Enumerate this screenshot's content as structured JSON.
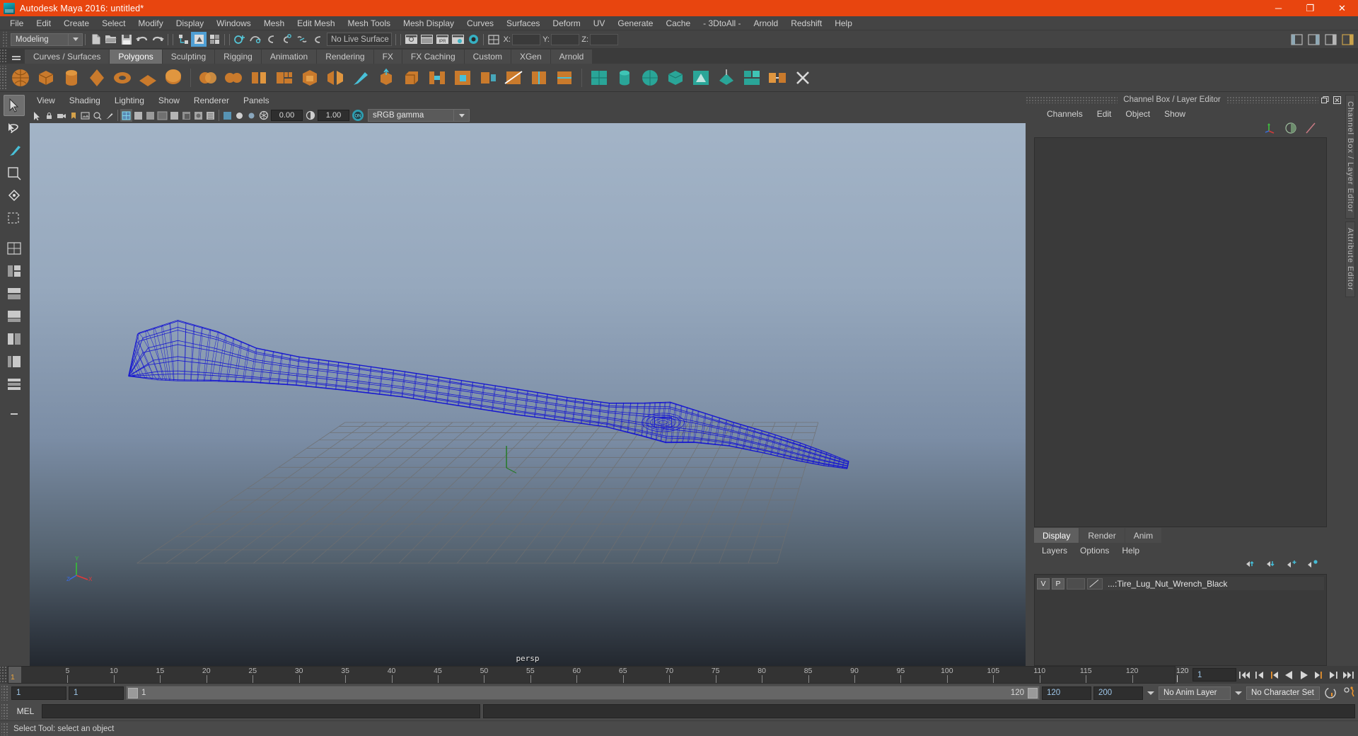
{
  "window": {
    "title": "Autodesk Maya 2016: untitled*",
    "icon": "maya-logo-icon",
    "minimize": "─",
    "maximize": "❐",
    "close": "✕",
    "accent_color": "#e8450f"
  },
  "menubar": {
    "items": [
      "File",
      "Edit",
      "Create",
      "Select",
      "Modify",
      "Display",
      "Windows",
      "Mesh",
      "Edit Mesh",
      "Mesh Tools",
      "Mesh Display",
      "Curves",
      "Surfaces",
      "Deform",
      "UV",
      "Generate",
      "Cache",
      "- 3DtoAll -",
      "Arnold",
      "Redshift",
      "Help"
    ]
  },
  "statusline": {
    "mode": "Modeling",
    "live_surface": "No Live Surface",
    "axis": {
      "x_label": "X:",
      "y_label": "Y:",
      "z_label": "Z:",
      "x_value": "",
      "y_value": "",
      "z_value": ""
    }
  },
  "shelf": {
    "tabs": [
      {
        "label": "Curves / Surfaces",
        "active": false
      },
      {
        "label": "Polygons",
        "active": true
      },
      {
        "label": "Sculpting",
        "active": false
      },
      {
        "label": "Rigging",
        "active": false
      },
      {
        "label": "Animation",
        "active": false
      },
      {
        "label": "Rendering",
        "active": false
      },
      {
        "label": "FX",
        "active": false
      },
      {
        "label": "FX Caching",
        "active": false
      },
      {
        "label": "Custom",
        "active": false
      },
      {
        "label": "XGen",
        "active": false
      },
      {
        "label": "Arnold",
        "active": false
      }
    ]
  },
  "viewport": {
    "menus": [
      "View",
      "Shading",
      "Lighting",
      "Show",
      "Renderer",
      "Panels"
    ],
    "exposure": "0.00",
    "gamma_value": "1.00",
    "color_management": "sRGB gamma",
    "camera_label": "persp",
    "model_name": "Tire_Lug_Nut_Wrench_Black",
    "wireframe_color": "#1616d8",
    "grid_color": "#6a6a6a"
  },
  "channelbox": {
    "title": "Channel Box / Layer Editor",
    "menus": [
      "Channels",
      "Edit",
      "Object",
      "Show"
    ],
    "restore_icon": "restore-icon",
    "close_icon": "close-icon"
  },
  "layereditor": {
    "tabs": [
      {
        "label": "Display",
        "active": true
      },
      {
        "label": "Render",
        "active": false
      },
      {
        "label": "Anim",
        "active": false
      }
    ],
    "menus": [
      "Layers",
      "Options",
      "Help"
    ],
    "layers": [
      {
        "visibility": "V",
        "playback": "P",
        "name": "...:Tire_Lug_Nut_Wrench_Black"
      }
    ]
  },
  "rail": {
    "tabs": [
      "Channel Box / Layer Editor",
      "Attribute Editor"
    ]
  },
  "timeline": {
    "current_frame": "1",
    "start_label": "1",
    "end_label": "120",
    "ticks": [
      5,
      10,
      15,
      20,
      25,
      30,
      35,
      40,
      45,
      50,
      55,
      60,
      65,
      70,
      75,
      80,
      85,
      90,
      95,
      100,
      105,
      110,
      115,
      120
    ],
    "frame_field": "1",
    "playback_buttons": [
      "go-to-start-icon",
      "step-back-frame-icon",
      "step-back-key-icon",
      "play-backwards-icon",
      "play-forwards-icon",
      "step-forward-key-icon",
      "step-forward-frame-icon",
      "go-to-end-icon"
    ]
  },
  "rangeslider": {
    "anim_start": "1",
    "range_start": "1",
    "slider_start_label": "1",
    "slider_end_label": "120",
    "range_end": "120",
    "anim_end": "200",
    "anim_layer": "No Anim Layer",
    "character_set": "No Character Set",
    "auto_key_icon": "auto-keyframe-icon",
    "anim_prefs_icon": "animation-preferences-icon"
  },
  "commandline": {
    "language": "MEL",
    "value": ""
  },
  "statusbar": {
    "message": "Select Tool: select an object"
  }
}
